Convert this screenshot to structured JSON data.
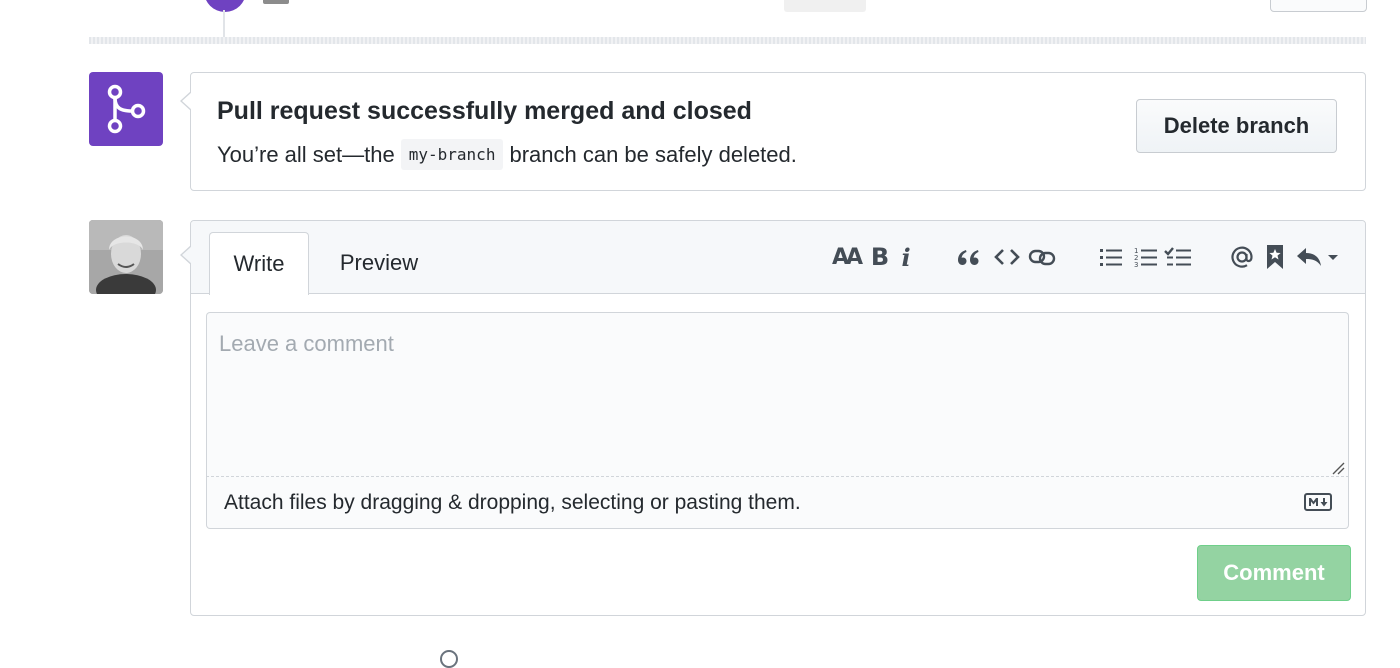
{
  "merge_status": {
    "title": "Pull request successfully merged and closed",
    "subtitle_prefix": "You’re all set—the",
    "branch_name": "my-branch",
    "subtitle_suffix": "branch can be safely deleted.",
    "delete_button_label": "Delete branch",
    "icon": "git-merge-icon",
    "accent_color": "#6f42c1"
  },
  "composer": {
    "tabs": [
      {
        "label": "Write",
        "active": true
      },
      {
        "label": "Preview",
        "active": false
      }
    ],
    "toolbar": {
      "header_label": "AA",
      "bold_label": "B",
      "italic_label": "i",
      "icons": [
        "header-icon",
        "bold-icon",
        "italic-icon",
        "quote-icon",
        "code-icon",
        "link-icon",
        "unordered-list-icon",
        "ordered-list-icon",
        "task-list-icon",
        "mention-icon",
        "saved-reply-icon",
        "reply-icon"
      ]
    },
    "textarea_placeholder": "Leave a comment",
    "attach_text": "Attach files by dragging & dropping, selecting or pasting them.",
    "markdown_icon": "markdown-icon",
    "comment_button_label": "Comment",
    "comment_button_color": "#94d3a2"
  }
}
